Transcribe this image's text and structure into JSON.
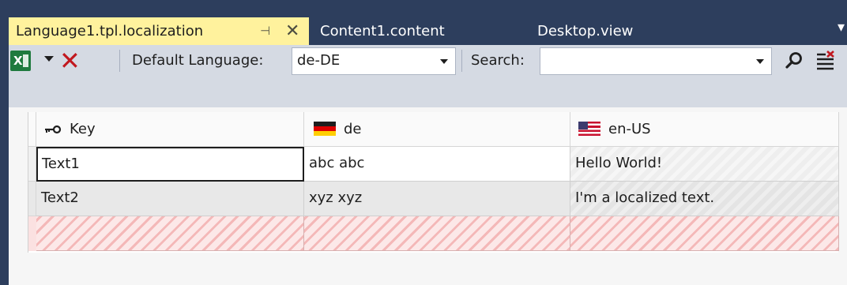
{
  "tabs": [
    {
      "label": "Language1.tpl.localization",
      "active": true,
      "pin_glyph": "⊣",
      "close_glyph": "✕"
    },
    {
      "label": "Content1.content",
      "active": false
    },
    {
      "label": "Desktop.view",
      "active": false
    }
  ],
  "toolbar": {
    "default_language_label": "Default Language:",
    "default_language_value": "de-DE",
    "search_label": "Search:",
    "search_value": "",
    "icons": [
      "excel-icon",
      "dropdown-arrow-icon",
      "delete-icon",
      "search-icon",
      "clear-filter-icon"
    ],
    "colors": {
      "delete": "#c1181f",
      "excel": "#1f7a3e"
    }
  },
  "grid": {
    "columns": [
      {
        "label": "Key",
        "icon": "key-icon"
      },
      {
        "label": "de",
        "icon": "flag-de-icon"
      },
      {
        "label": "en-US",
        "icon": "flag-us-icon"
      }
    ],
    "rows": [
      {
        "key": "Text1",
        "de": "abc abc",
        "en_us": "Hello World!"
      },
      {
        "key": "Text2",
        "de": "xyz xyz",
        "en_us": "I'm a localized text."
      }
    ]
  },
  "theme": {
    "tab_bar": "#2d3e5d",
    "active_tab": "#fff29d",
    "toolbar": "#d5dae3",
    "new_row_hatch": "#f4b8b8"
  }
}
